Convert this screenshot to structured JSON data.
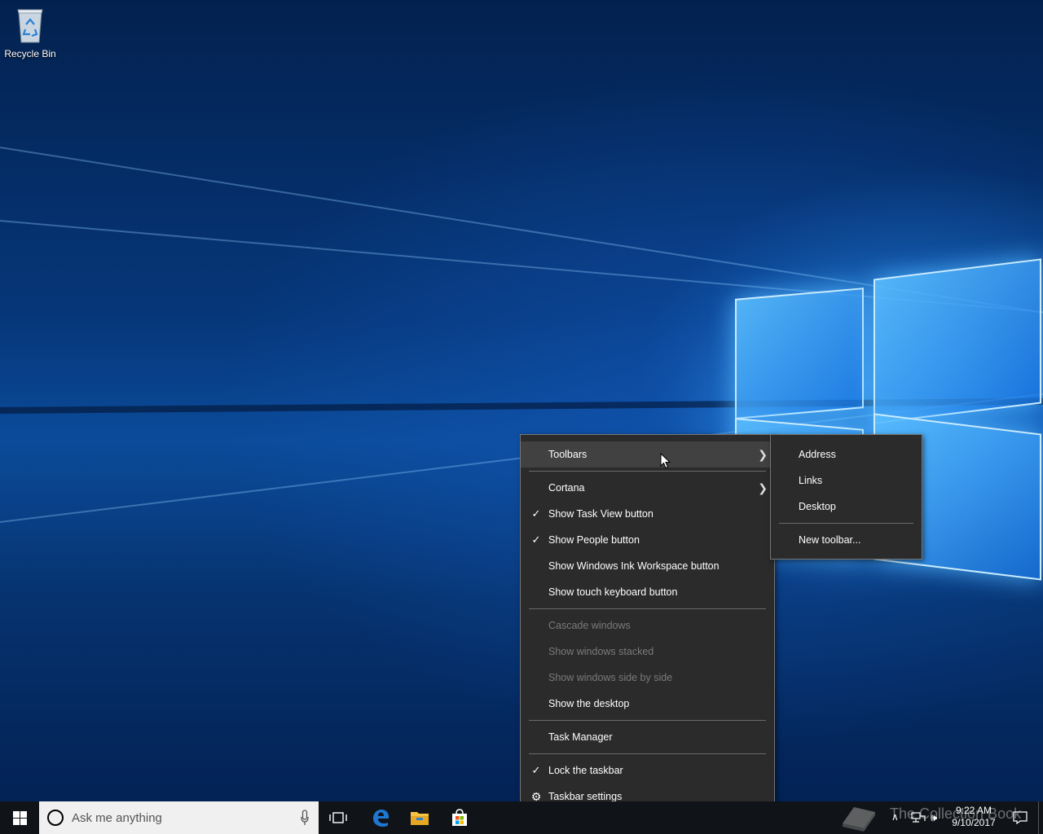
{
  "desktop": {
    "icons": [
      {
        "label": "Recycle Bin",
        "icon": "recycle-bin-icon"
      }
    ]
  },
  "context_menu": {
    "items": [
      {
        "label": "Toolbars",
        "submenu": true,
        "highlighted": true
      },
      {
        "label": "Cortana",
        "submenu": true
      },
      {
        "label": "Show Task View button",
        "checked": true
      },
      {
        "label": "Show People button",
        "checked": true
      },
      {
        "label": "Show Windows Ink Workspace button"
      },
      {
        "label": "Show touch keyboard button"
      },
      {
        "label": "Cascade windows",
        "disabled": true
      },
      {
        "label": "Show windows stacked",
        "disabled": true
      },
      {
        "label": "Show windows side by side",
        "disabled": true
      },
      {
        "label": "Show the desktop"
      },
      {
        "label": "Task Manager"
      },
      {
        "label": "Lock the taskbar",
        "checked": true
      },
      {
        "label": "Taskbar settings",
        "icon": "gear-icon"
      }
    ]
  },
  "toolbars_submenu": {
    "items": [
      {
        "label": "Address"
      },
      {
        "label": "Links"
      },
      {
        "label": "Desktop"
      },
      {
        "label": "New toolbar..."
      }
    ]
  },
  "taskbar": {
    "search_placeholder": "Ask me anything",
    "pinned_apps": [
      "task-view-icon",
      "edge-icon",
      "file-explorer-icon",
      "store-icon"
    ],
    "tray": {
      "time": "9:22 AM",
      "date": "9/10/2017"
    }
  },
  "watermark": {
    "text": "The Collection Book"
  },
  "colors": {
    "menu_bg": "#2b2b2b",
    "menu_highlight": "#414141",
    "menu_disabled_text": "#7a7a7a",
    "taskbar_bg": "#101418",
    "edge_blue": "#1e77d3",
    "explorer_yellow": "#f5c242"
  }
}
